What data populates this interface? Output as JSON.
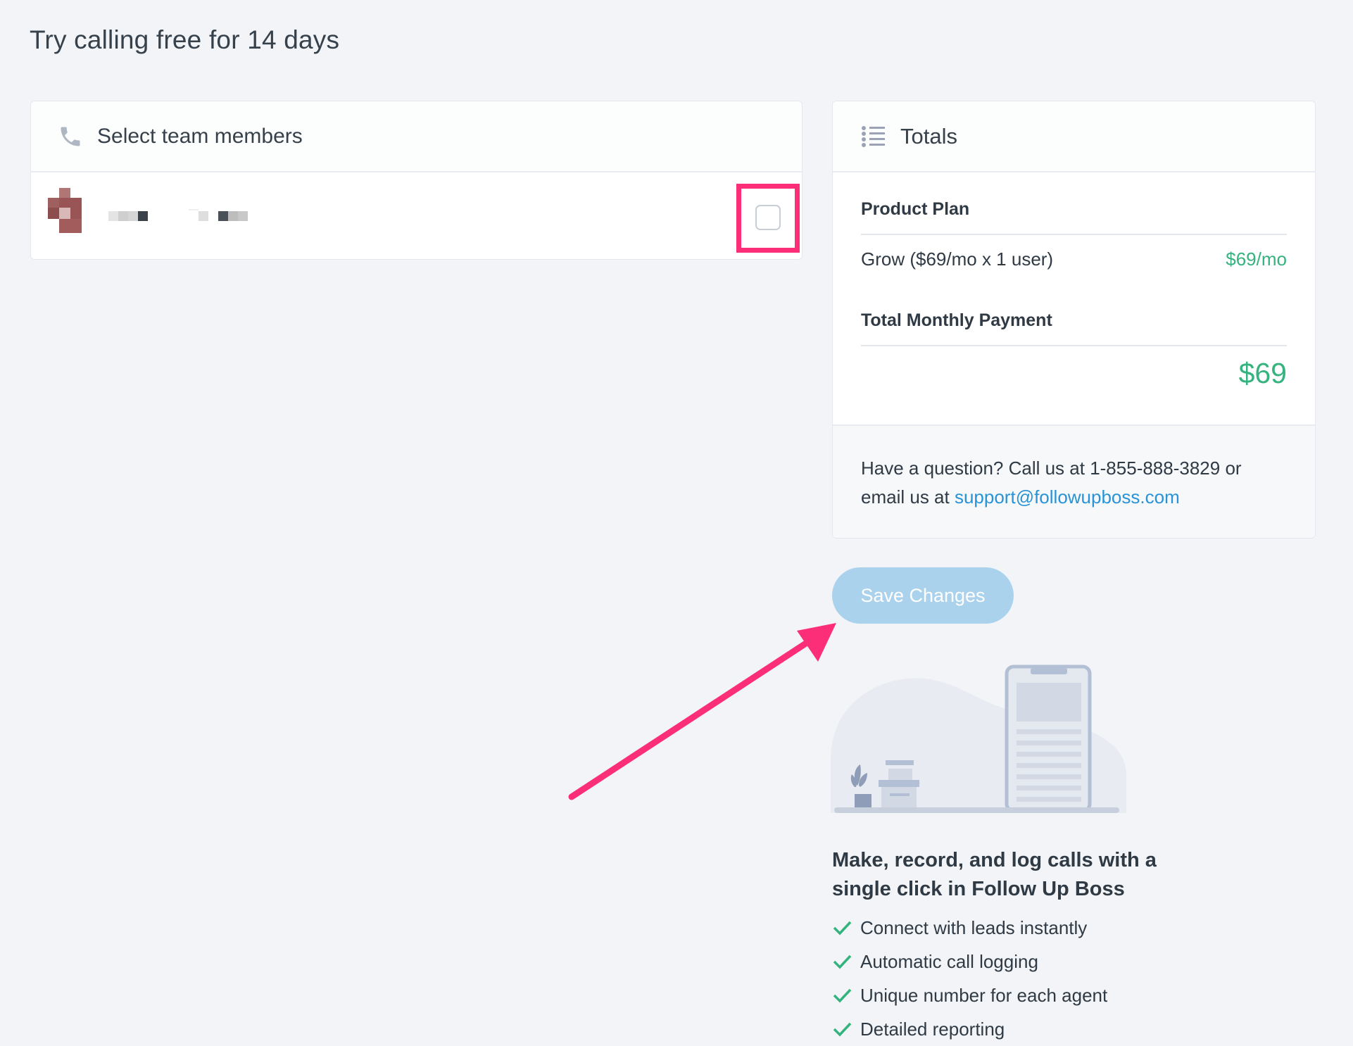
{
  "page": {
    "title": "Try calling free for 14 days"
  },
  "team_card": {
    "header_label": "Select team members",
    "header_icon": "phone-icon",
    "member_checkbox_checked": false
  },
  "totals_card": {
    "header_label": "Totals",
    "header_icon": "list-icon",
    "product_plan_title": "Product Plan",
    "plan_name": "Grow ($69/mo x 1 user)",
    "plan_price": "$69/mo",
    "total_title": "Total Monthly Payment",
    "total_amount": "$69",
    "help_text": "Have a question? Call us at 1-855-888-3829 or email us at",
    "help_email": "support@followupboss.com"
  },
  "actions": {
    "save_label": "Save Changes"
  },
  "promo": {
    "title": "Make, record, and log calls with a single click in Follow Up Boss",
    "features": [
      "Connect with leads instantly",
      "Automatic call logging",
      "Unique number for each agent",
      "Detailed reporting"
    ]
  },
  "colors": {
    "accent_green": "#35b37e",
    "link_blue": "#2a93d5",
    "button_disabled": "#abd2ec",
    "highlight_pink": "#fc2e77",
    "background": "#f2f4f7"
  }
}
